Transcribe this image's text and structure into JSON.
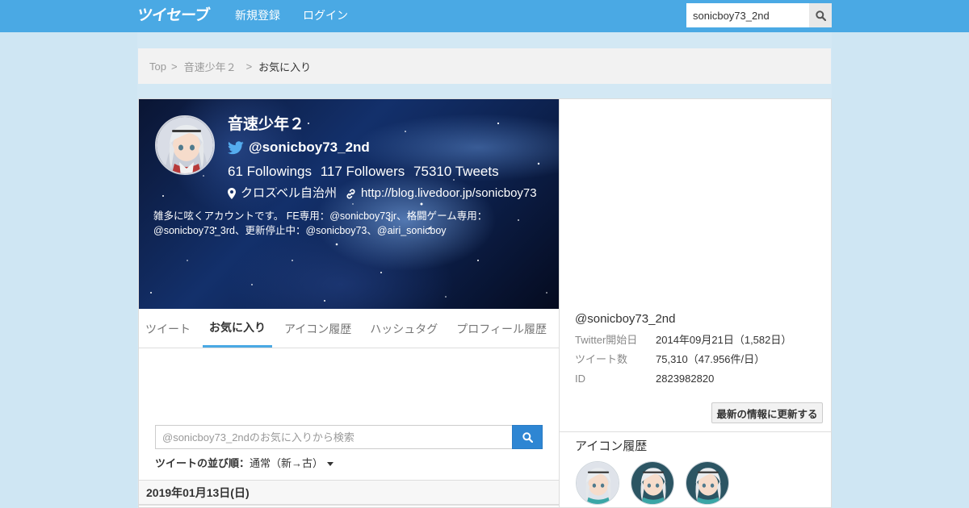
{
  "header": {
    "logo": "ツイセーブ",
    "nav": {
      "signup": "新規登録",
      "login": "ログイン"
    },
    "search": {
      "value": "sonicboy73_2nd"
    },
    "colors": {
      "bar": "#4aa9e4"
    }
  },
  "breadcrumb": {
    "top": "Top",
    "user": "音速少年２",
    "current": "お気に入り",
    "separator": ">"
  },
  "profile": {
    "name": "音速少年２",
    "handle": "@sonicboy73_2nd",
    "followings": "61",
    "followings_label": "Followings",
    "followers": "117",
    "followers_label": "Followers",
    "tweets": "75310",
    "tweets_label": "Tweets",
    "location": "クロスベル自治州",
    "url": "http://blog.livedoor.jp/sonicboy73",
    "bio": "雑多に呟くアカウントです。 FE専用：@sonicboy73jr、格闘ゲーム専用：@sonicboy73_3rd、更新停止中：@sonicboy73、@airi_sonicboy"
  },
  "tabs": [
    {
      "label": "ツイート",
      "active": false
    },
    {
      "label": "お気に入り",
      "active": true
    },
    {
      "label": "アイコン履歴",
      "active": false
    },
    {
      "label": "ハッシュタグ",
      "active": false
    },
    {
      "label": "プロフィール履歴",
      "active": false
    }
  ],
  "favorites": {
    "search_placeholder": "@sonicboy73_2ndのお気に入りから検索",
    "sort_label": "ツイートの並び順：",
    "sort_value": "通常（新→古）",
    "date_header": "2019年01月13日(日)"
  },
  "sidebar": {
    "handle": "@sonicboy73_2nd",
    "info": [
      {
        "label": "Twitter開始日",
        "value": "2014年09月21日（1,582日）"
      },
      {
        "label": "ツイート数",
        "value": "75,310（47.956件/日）"
      },
      {
        "label": "ID",
        "value": "2823982820"
      }
    ],
    "update_button": "最新の情報に更新する",
    "icon_history_title": "アイコン履歴",
    "icon_history_count": 3
  }
}
